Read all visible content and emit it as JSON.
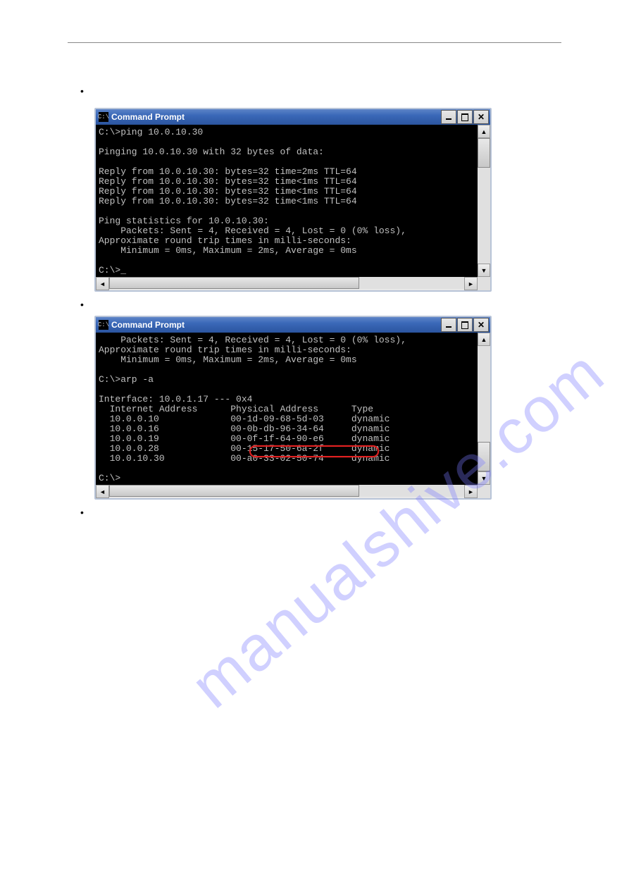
{
  "hr": true,
  "bullets": {
    "b1": "•",
    "b2": "•",
    "b3": "•"
  },
  "win1": {
    "icon_text": "C:\\",
    "title": "Command Prompt",
    "terminal": "C:\\>ping 10.0.10.30\n\nPinging 10.0.10.30 with 32 bytes of data:\n\nReply from 10.0.10.30: bytes=32 time=2ms TTL=64\nReply from 10.0.10.30: bytes=32 time<1ms TTL=64\nReply from 10.0.10.30: bytes=32 time<1ms TTL=64\nReply from 10.0.10.30: bytes=32 time<1ms TTL=64\n\nPing statistics for 10.0.10.30:\n    Packets: Sent = 4, Received = 4, Lost = 0 (0% loss),\nApproximate round trip times in milli-seconds:\n    Minimum = 0ms, Maximum = 2ms, Average = 0ms\n\nC:\\>_"
  },
  "win2": {
    "icon_text": "C:\\",
    "title": "Command Prompt",
    "terminal": "    Packets: Sent = 4, Received = 4, Lost = 0 (0% loss),\nApproximate round trip times in milli-seconds:\n    Minimum = 0ms, Maximum = 2ms, Average = 0ms\n\nC:\\>arp -a\n\nInterface: 10.0.1.17 --- 0x4\n  Internet Address      Physical Address      Type\n  10.0.0.10             00-1d-09-68-5d-03     dynamic\n  10.0.0.16             00-0b-db-96-34-64     dynamic\n  10.0.0.19             00-0f-1f-64-90-e6     dynamic\n  10.0.0.28             00-15-17-50-6a-2f     dynamic\n  10.0.10.30            00-a0-33-02-50-74     dynamic\n\nC:\\>",
    "highlight_mac": "00-a0-33-02-50-74"
  },
  "watermark": "manualshive.com"
}
